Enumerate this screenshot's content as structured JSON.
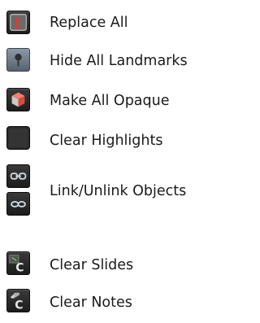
{
  "menu": {
    "items": [
      {
        "label": "Replace All",
        "icon": "replace-all-icon"
      },
      {
        "label": "Hide All Landmarks",
        "icon": "landmark-pin-icon"
      },
      {
        "label": "Make All Opaque",
        "icon": "opaque-cube-icon"
      },
      {
        "label": "Clear Highlights",
        "icon": "clear-highlights-icon"
      },
      {
        "label": "Link/Unlink Objects",
        "icon": "link-unlink-icon"
      },
      {
        "label": "Clear Slides",
        "icon": "clear-slides-icon"
      },
      {
        "label": "Clear Notes",
        "icon": "clear-notes-icon"
      }
    ]
  },
  "colors": {
    "text": "#1a1a1a",
    "icon_bg_dark": "#2a2a2a",
    "icon_accent_red": "#e23a2a",
    "icon_accent_blue": "#7fb6e6",
    "icon_glyph_light": "#dcdcdc"
  }
}
